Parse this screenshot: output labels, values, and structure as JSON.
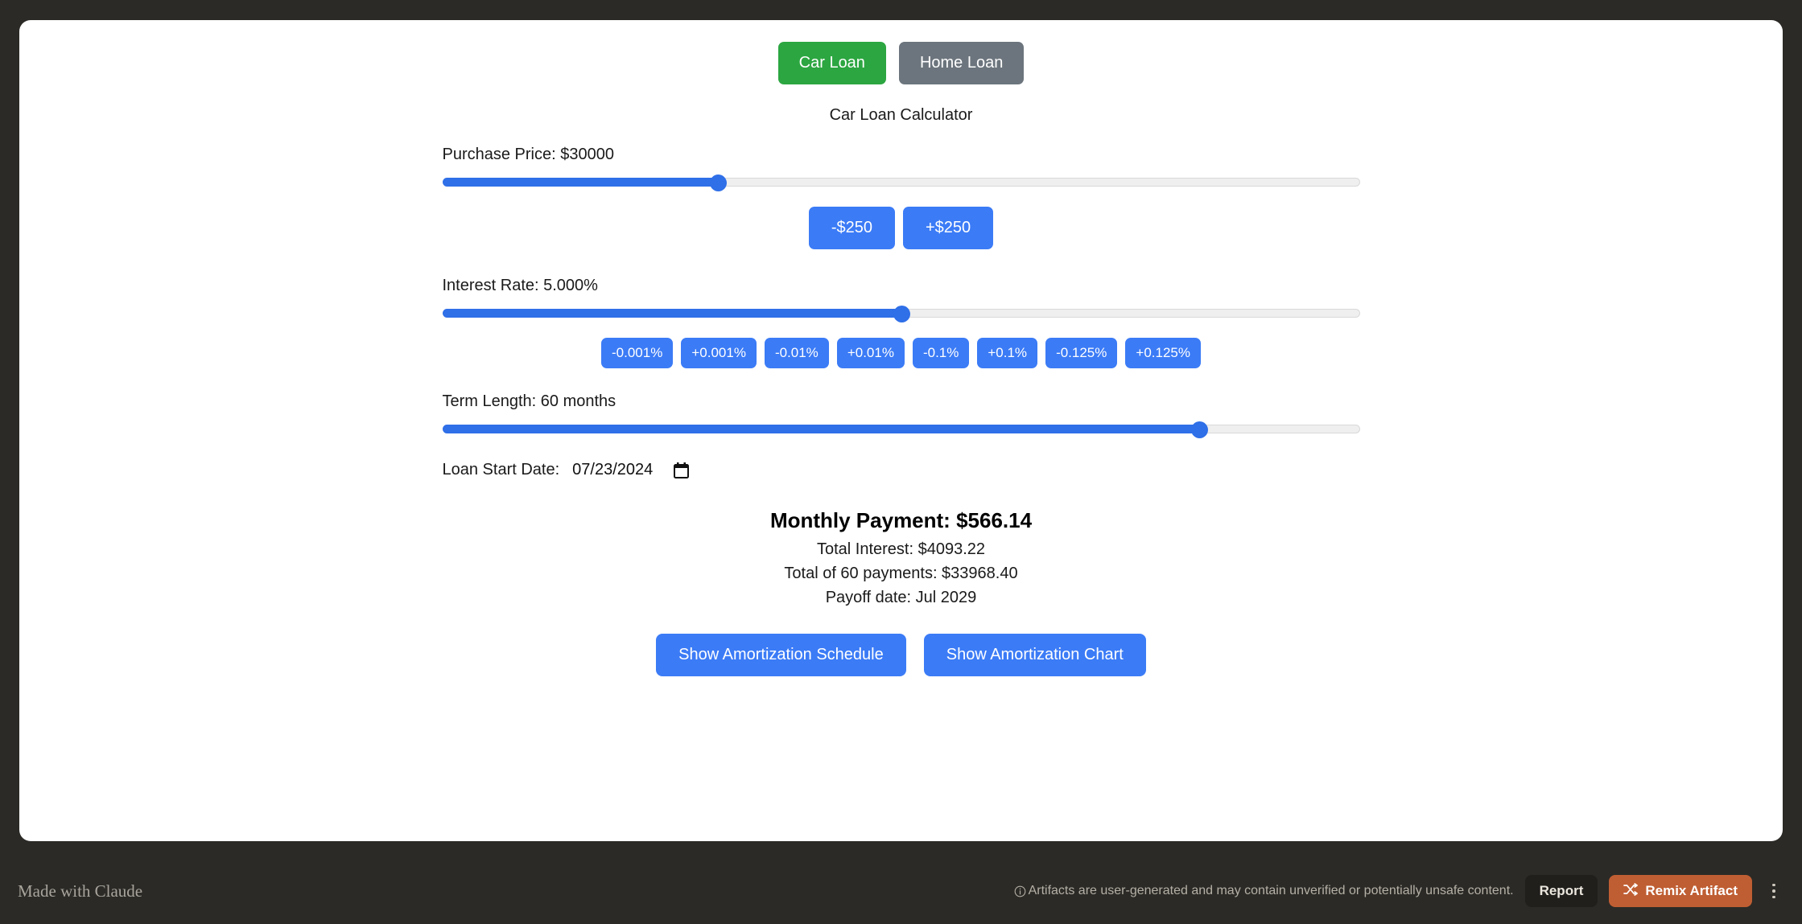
{
  "tabs": [
    {
      "label": "Car Loan",
      "state": "active",
      "color": "#2ca641"
    },
    {
      "label": "Home Loan",
      "state": "inactive",
      "color": "#6c757d"
    }
  ],
  "calculator": {
    "title": "Car Loan Calculator",
    "purchase_price": {
      "label": "Purchase Price: $30000",
      "value": 30000,
      "slider_percent": 30,
      "steppers": [
        {
          "label": "-$250"
        },
        {
          "label": "+$250"
        }
      ]
    },
    "interest_rate": {
      "label": "Interest Rate: 5.000%",
      "value": 5.0,
      "slider_percent": 50,
      "steppers": [
        {
          "label": "-0.001%"
        },
        {
          "label": "+0.001%"
        },
        {
          "label": "-0.01%"
        },
        {
          "label": "+0.01%"
        },
        {
          "label": "-0.1%"
        },
        {
          "label": "+0.1%"
        },
        {
          "label": "-0.125%"
        },
        {
          "label": "+0.125%"
        }
      ]
    },
    "term_length": {
      "label": "Term Length: 60 months",
      "value": 60,
      "slider_percent": 82.5
    },
    "loan_start_date": {
      "label": "Loan Start Date:",
      "value": "07/23/2024"
    },
    "results": {
      "monthly_payment": "Monthly Payment: $566.14",
      "total_interest": "Total Interest: $4093.22",
      "total_payments": "Total of 60 payments: $33968.40",
      "payoff_date": "Payoff date: Jul 2029"
    },
    "actions": [
      {
        "label": "Show Amortization Schedule"
      },
      {
        "label": "Show Amortization Chart"
      }
    ]
  },
  "footer": {
    "made_with": "Made with Claude",
    "disclaimer": "Artifacts are user-generated and may contain unverified or potentially unsafe content.",
    "report_label": "Report",
    "remix_label": "Remix Artifact",
    "remix_color": "#bf5e33"
  }
}
